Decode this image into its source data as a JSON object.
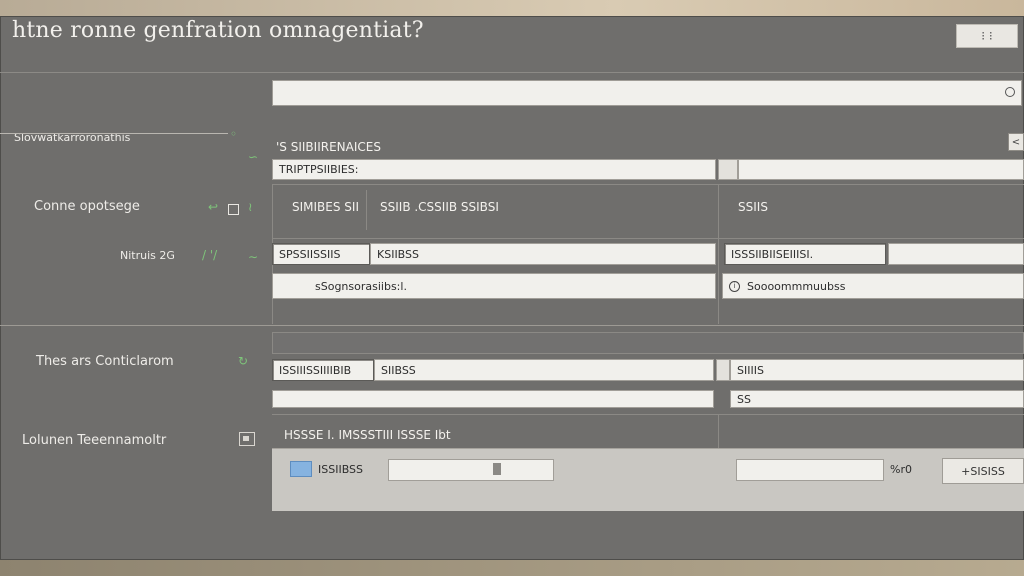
{
  "window": {
    "title": "htne ronne genfration omnagentiat?",
    "top_button": "⁝ ⁝"
  },
  "search": {
    "value": "",
    "placeholder": ""
  },
  "sidebar": {
    "section_heading": "Slovwatkarroronathis",
    "options_label": "Conne opotsege",
    "status_label": "Nitruis 2G",
    "status_mark": "/ '/",
    "config_label": "Thes ars Conticlarom",
    "lower_label": "Lolunen Teeennamoltr"
  },
  "form": {
    "header_row": "'S    SIIBIIRENAICES",
    "row1_field": "TRIPTPSIIBIES:",
    "col_a_header": "SIMIBES SII",
    "col_b_header": "SSIIB  .CSSIIB SSIBSI",
    "col_c_header": "SSIIS",
    "row2_left": "SPSSIISSIIS",
    "row2_mid": "KSIIBSS",
    "row2_right": "ISSSIIBIISEIIISI.",
    "row3_mid": "sSognsorasiibs:l.",
    "row3_right": "Soooommmuubss",
    "config_left": "ISSIIISSIIIIBIB",
    "config_mid": "SIIBSS",
    "config_right": "SIIIIS",
    "config_row2_right": "SS",
    "lower_header": "HSSSE I. IMSSSTIII ISSSE Ibt",
    "lower_swatch_label": "ISSIIBSS",
    "lower_right_label": "%r0",
    "lower_button": "+SISISS"
  },
  "colors": {
    "window_bg": "#6f6e6c",
    "field_bg": "#f1f0ec",
    "accent_green": "#7ec47a",
    "accent_blue": "#86b3e0"
  }
}
